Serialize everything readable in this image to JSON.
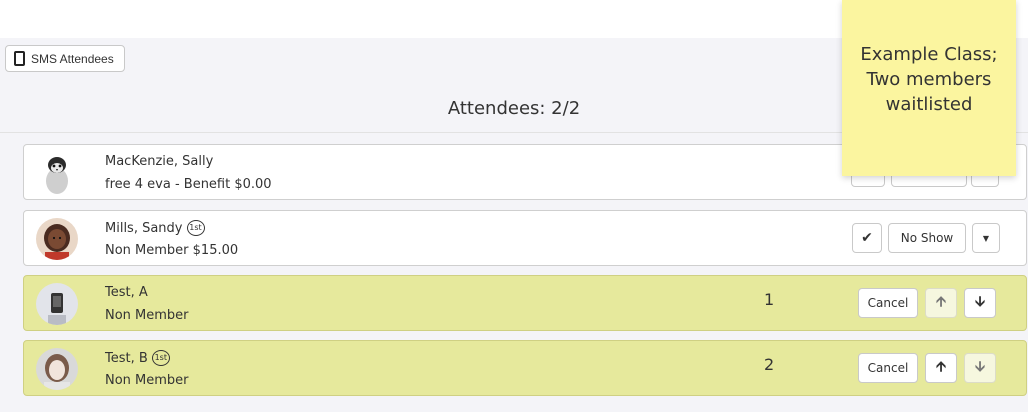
{
  "toolbar": {
    "sms_label": "SMS Attendees"
  },
  "header": {
    "title": "Attendees: 2/2"
  },
  "attendees": [
    {
      "name": "MacKenzie, Sally",
      "first_visit": false,
      "membership": "free 4 eva - Benefit $0.00",
      "avatar": "penguin-avatar"
    },
    {
      "name": "Mills, Sandy",
      "first_visit": true,
      "badge": "1st",
      "membership": "Non Member $15.00",
      "avatar": "person-avatar",
      "actions": {
        "check_icon": "check-icon",
        "no_show_label": "No Show",
        "dropdown_icon": "caret-down-icon"
      }
    }
  ],
  "waitlist": [
    {
      "name": "Test, A",
      "membership": "Non Member",
      "position": "1",
      "cancel_label": "Cancel",
      "up_enabled": false,
      "down_enabled": true
    },
    {
      "name": "Test, B",
      "badge": "1st",
      "membership": "Non Member",
      "position": "2",
      "cancel_label": "Cancel",
      "up_enabled": true,
      "down_enabled": false
    }
  ],
  "sticky_note": {
    "text_line1": "Example Class;",
    "text_line2": "Two members",
    "text_line3": "waitlisted"
  },
  "colors": {
    "waitlist_bg": "#e6e99c",
    "note_bg": "#fbf59f",
    "panel_bg": "#f4f4f8"
  }
}
